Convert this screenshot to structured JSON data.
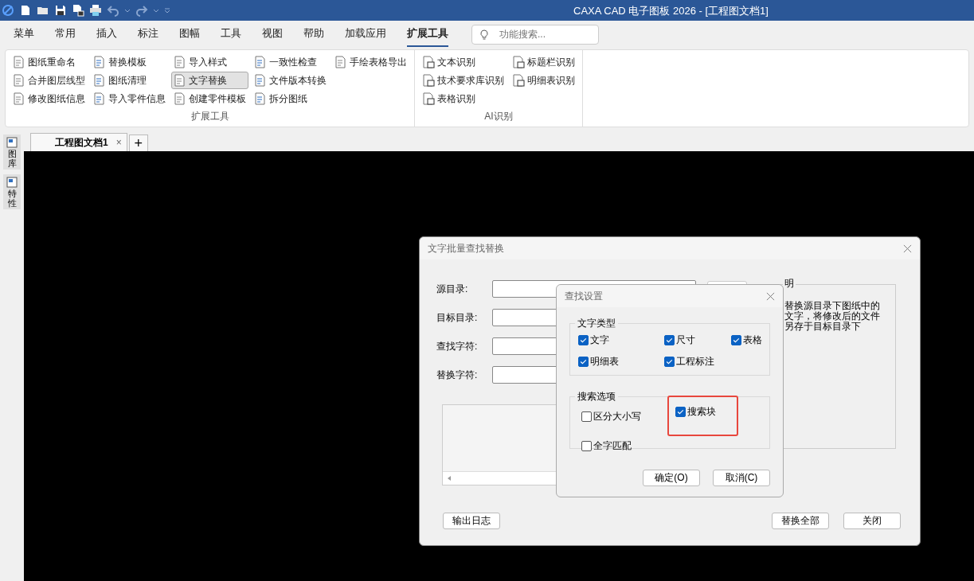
{
  "window": {
    "title": "CAXA CAD 电子图板 2026 - [工程图文档1]"
  },
  "menu_tabs": [
    {
      "label": "菜单",
      "selected": false
    },
    {
      "label": "常用",
      "selected": false
    },
    {
      "label": "插入",
      "selected": false
    },
    {
      "label": "标注",
      "selected": false
    },
    {
      "label": "图幅",
      "selected": false
    },
    {
      "label": "工具",
      "selected": false
    },
    {
      "label": "视图",
      "selected": false
    },
    {
      "label": "帮助",
      "selected": false
    },
    {
      "label": "加载应用",
      "selected": false
    },
    {
      "label": "扩展工具",
      "selected": true
    }
  ],
  "search": {
    "placeholder": "功能搜索..."
  },
  "ribbon": {
    "groups": [
      {
        "label": "扩展工具",
        "columns": [
          [
            {
              "label": "图纸重命名",
              "selected": false
            },
            {
              "label": "合并图层线型",
              "selected": false
            },
            {
              "label": "修改图纸信息",
              "selected": false
            }
          ],
          [
            {
              "label": "替换模板",
              "selected": false
            },
            {
              "label": "图纸清理",
              "selected": false
            },
            {
              "label": "导入零件信息",
              "selected": false
            }
          ],
          [
            {
              "label": "导入样式",
              "selected": false
            },
            {
              "label": "文字替换",
              "selected": true
            },
            {
              "label": "创建零件模板",
              "selected": false
            }
          ],
          [
            {
              "label": "一致性检查",
              "selected": false
            },
            {
              "label": "文件版本转换",
              "selected": false
            },
            {
              "label": "拆分图纸",
              "selected": false
            }
          ],
          [
            {
              "label": "手绘表格导出",
              "selected": false
            }
          ]
        ]
      },
      {
        "label": "AI识别",
        "columns": [
          [
            {
              "label": "文本识别",
              "selected": false
            },
            {
              "label": "技术要求库识别",
              "selected": false
            },
            {
              "label": "表格识别",
              "selected": false
            }
          ],
          [
            {
              "label": "标题栏识别",
              "selected": false
            },
            {
              "label": "明细表识别",
              "selected": false
            }
          ]
        ]
      }
    ]
  },
  "side_tabs": [
    {
      "label": "图库"
    },
    {
      "label": "特性"
    }
  ],
  "document_tabs": [
    {
      "label": "工程图文档1",
      "close": "×",
      "selected": true
    }
  ],
  "new_tab": "+",
  "dialog": {
    "title": "文字批量查找替换",
    "fields": [
      {
        "label": "源目录:"
      },
      {
        "label": "目标目录:"
      },
      {
        "label": "查找字符:"
      },
      {
        "label": "替换字符:"
      }
    ],
    "description_label": "明",
    "description": "替换源目录下图纸中的文字，将修改后的文件另存于目标目录下",
    "buttons": {
      "log": "输出日志",
      "replace_all": "替换全部",
      "close": "关闭"
    }
  },
  "find_settings": {
    "title": "查找设置",
    "text_types_label": "文字类型",
    "text_types": [
      {
        "label": "文字",
        "checked": true
      },
      {
        "label": "尺寸",
        "checked": true
      },
      {
        "label": "表格",
        "checked": true
      },
      {
        "label": "明细表",
        "checked": true
      },
      {
        "label": "工程标注",
        "checked": true
      }
    ],
    "search_options_label": "搜索选项",
    "search_options": [
      {
        "label": "区分大小写",
        "checked": false,
        "highlighted": false
      },
      {
        "label": "搜索块",
        "checked": true,
        "highlighted": true
      },
      {
        "label": "全字匹配",
        "checked": false,
        "highlighted": false
      }
    ],
    "ok": "确定(O)",
    "cancel": "取消(C)"
  }
}
